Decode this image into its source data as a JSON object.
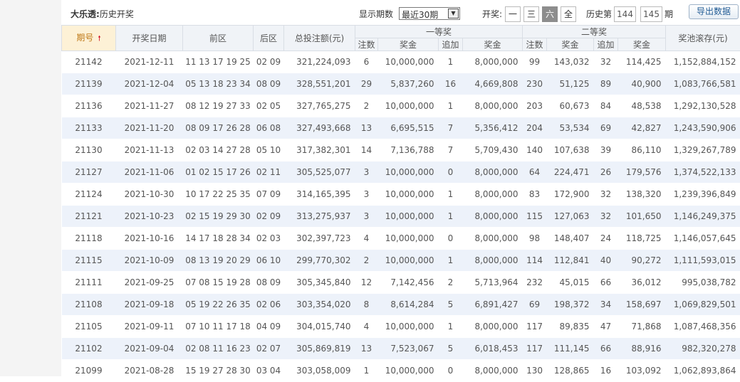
{
  "toolbar": {
    "title_bold": "大乐透:",
    "title_rest": "历史开奖",
    "display_label": "显示期数",
    "display_select": "最近30期",
    "kaijiang_label": "开奖:",
    "buttons": [
      "一",
      "三",
      "六",
      "全"
    ],
    "active_button_index": 2,
    "history_label": "历史第",
    "history_from": "144",
    "history_to": "145",
    "history_unit": "期",
    "export_label": "导出数据"
  },
  "headers": {
    "issue": "期号",
    "date": "开奖日期",
    "front": "前区",
    "back": "后区",
    "total_bets": "总投注额(元)",
    "first_prize": "一等奖",
    "second_prize": "二等奖",
    "pool": "奖池滚存(元)",
    "sub": [
      "注数",
      "奖金",
      "追加",
      "奖金",
      "注数",
      "奖金",
      "追加",
      "奖金"
    ]
  },
  "colors": {
    "front": "#e60012",
    "back": "#1c5fb1",
    "count": "#e60012",
    "row_alt": "#edf2fa"
  },
  "rows": [
    {
      "issue": "21142",
      "date": "2021-12-11",
      "front": "11 13 17 19 25",
      "back": "02 09",
      "total": "321,224,093",
      "c1": "6",
      "p1": "10,000,000",
      "a1": "1",
      "ap1": "8,000,000",
      "c2": "99",
      "p2": "143,032",
      "a2": "32",
      "ap2": "114,425",
      "pool": "1,152,884,152"
    },
    {
      "issue": "21139",
      "date": "2021-12-04",
      "front": "05 13 18 23 34",
      "back": "08 09",
      "total": "328,551,201",
      "c1": "29",
      "p1": "5,837,260",
      "a1": "16",
      "ap1": "4,669,808",
      "c2": "230",
      "p2": "51,125",
      "a2": "89",
      "ap2": "40,900",
      "pool": "1,083,766,581"
    },
    {
      "issue": "21136",
      "date": "2021-11-27",
      "front": "08 12 19 27 33",
      "back": "02 05",
      "total": "327,765,275",
      "c1": "2",
      "p1": "10,000,000",
      "a1": "1",
      "ap1": "8,000,000",
      "c2": "203",
      "p2": "60,673",
      "a2": "84",
      "ap2": "48,538",
      "pool": "1,292,130,528"
    },
    {
      "issue": "21133",
      "date": "2021-11-20",
      "front": "08 09 17 26 28",
      "back": "06 08",
      "total": "327,493,668",
      "c1": "13",
      "p1": "6,695,515",
      "a1": "7",
      "ap1": "5,356,412",
      "c2": "204",
      "p2": "53,534",
      "a2": "69",
      "ap2": "42,827",
      "pool": "1,243,590,906"
    },
    {
      "issue": "21130",
      "date": "2021-11-13",
      "front": "02 03 14 27 28",
      "back": "05 10",
      "total": "317,382,301",
      "c1": "14",
      "p1": "7,136,788",
      "a1": "7",
      "ap1": "5,709,430",
      "c2": "140",
      "p2": "107,638",
      "a2": "39",
      "ap2": "86,110",
      "pool": "1,329,267,789"
    },
    {
      "issue": "21127",
      "date": "2021-11-06",
      "front": "01 02 15 17 26",
      "back": "02 11",
      "total": "305,525,077",
      "c1": "3",
      "p1": "10,000,000",
      "a1": "0",
      "ap1": "8,000,000",
      "c2": "64",
      "p2": "224,471",
      "a2": "26",
      "ap2": "179,576",
      "pool": "1,374,522,133"
    },
    {
      "issue": "21124",
      "date": "2021-10-30",
      "front": "10 17 22 25 35",
      "back": "07 09",
      "total": "314,165,395",
      "c1": "3",
      "p1": "10,000,000",
      "a1": "1",
      "ap1": "8,000,000",
      "c2": "83",
      "p2": "172,900",
      "a2": "32",
      "ap2": "138,320",
      "pool": "1,239,396,849"
    },
    {
      "issue": "21121",
      "date": "2021-10-23",
      "front": "02 15 19 29 30",
      "back": "02 09",
      "total": "313,275,937",
      "c1": "3",
      "p1": "10,000,000",
      "a1": "1",
      "ap1": "8,000,000",
      "c2": "115",
      "p2": "127,063",
      "a2": "32",
      "ap2": "101,650",
      "pool": "1,146,249,375"
    },
    {
      "issue": "21118",
      "date": "2021-10-16",
      "front": "14 17 18 28 34",
      "back": "02 03",
      "total": "302,397,723",
      "c1": "4",
      "p1": "10,000,000",
      "a1": "0",
      "ap1": "8,000,000",
      "c2": "98",
      "p2": "148,407",
      "a2": "24",
      "ap2": "118,725",
      "pool": "1,146,057,645"
    },
    {
      "issue": "21115",
      "date": "2021-10-09",
      "front": "08 13 19 20 29",
      "back": "06 10",
      "total": "299,770,302",
      "c1": "2",
      "p1": "10,000,000",
      "a1": "1",
      "ap1": "8,000,000",
      "c2": "114",
      "p2": "112,841",
      "a2": "40",
      "ap2": "90,272",
      "pool": "1,111,593,015"
    },
    {
      "issue": "21111",
      "date": "2021-09-25",
      "front": "07 08 15 19 28",
      "back": "08 09",
      "total": "305,345,840",
      "c1": "12",
      "p1": "7,142,456",
      "a1": "2",
      "ap1": "5,713,964",
      "c2": "232",
      "p2": "45,015",
      "a2": "66",
      "ap2": "36,012",
      "pool": "995,038,782"
    },
    {
      "issue": "21108",
      "date": "2021-09-18",
      "front": "05 19 22 26 35",
      "back": "02 06",
      "total": "303,354,020",
      "c1": "8",
      "p1": "8,614,284",
      "a1": "5",
      "ap1": "6,891,427",
      "c2": "69",
      "p2": "198,372",
      "a2": "34",
      "ap2": "158,697",
      "pool": "1,069,829,501"
    },
    {
      "issue": "21105",
      "date": "2021-09-11",
      "front": "07 10 11 17 18",
      "back": "04 09",
      "total": "304,015,740",
      "c1": "4",
      "p1": "10,000,000",
      "a1": "1",
      "ap1": "8,000,000",
      "c2": "117",
      "p2": "89,835",
      "a2": "47",
      "ap2": "71,868",
      "pool": "1,087,468,356"
    },
    {
      "issue": "21102",
      "date": "2021-09-04",
      "front": "02 08 11 16 23",
      "back": "02 07",
      "total": "305,869,819",
      "c1": "13",
      "p1": "7,523,067",
      "a1": "5",
      "ap1": "6,018,453",
      "c2": "117",
      "p2": "111,145",
      "a2": "66",
      "ap2": "88,916",
      "pool": "982,320,278"
    },
    {
      "issue": "21099",
      "date": "2021-08-28",
      "front": "15 19 27 28 30",
      "back": "03 04",
      "total": "303,058,009",
      "c1": "1",
      "p1": "10,000,000",
      "a1": "0",
      "ap1": "8,000,000",
      "c2": "130",
      "p2": "128,865",
      "a2": "16",
      "ap2": "103,092",
      "pool": "1,062,893,864"
    }
  ]
}
